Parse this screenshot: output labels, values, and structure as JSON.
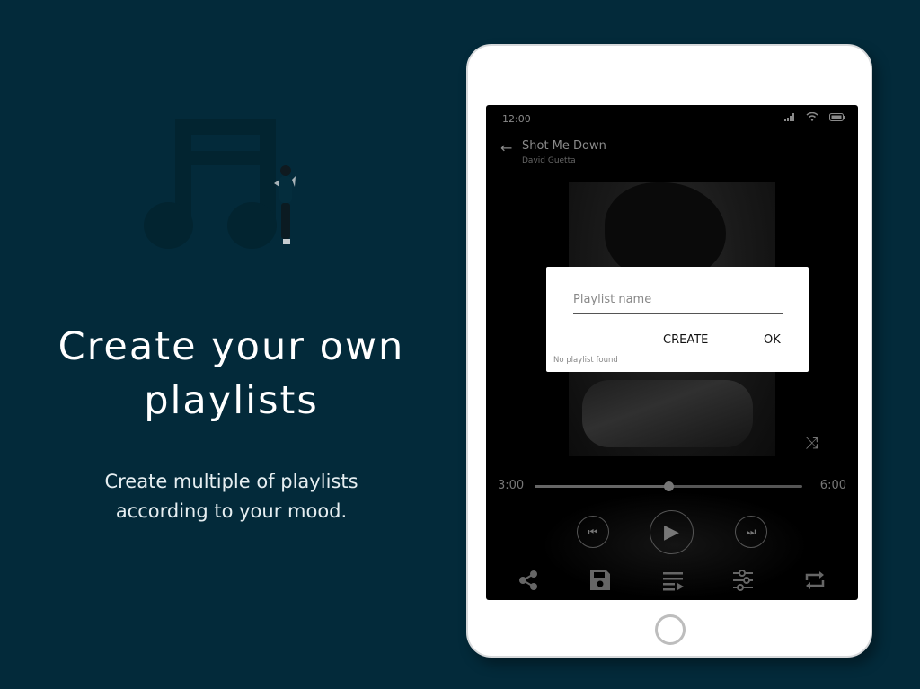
{
  "promo": {
    "headline_line1": "Create your own",
    "headline_line2": "playlists",
    "subtext_line1": "Create multiple of playlists",
    "subtext_line2": "according to your mood."
  },
  "colors": {
    "background": "#032a3a",
    "illustration": "#022430",
    "screen": "#000000",
    "dialog": "#ffffff"
  },
  "status_bar": {
    "time": "12:00",
    "icons": [
      "signal-icon",
      "wifi-icon",
      "battery-icon"
    ]
  },
  "player": {
    "back_icon": "←",
    "song_title": "Shot Me Down",
    "artist": "David Guetta",
    "shuffle_icon": "⤨",
    "elapsed": "3:00",
    "duration": "6:00",
    "progress": 0.5,
    "prev_icon": "⏮",
    "play_icon": "▶",
    "next_icon": "⏭",
    "bottom_icons": [
      {
        "name": "share-icon",
        "glyph": "⋖"
      },
      {
        "name": "save-icon",
        "glyph": "💾"
      },
      {
        "name": "queue-icon",
        "glyph": "≡"
      },
      {
        "name": "equalizer-icon",
        "glyph": "⚙"
      },
      {
        "name": "repeat-icon",
        "glyph": "⇄"
      }
    ]
  },
  "dialog": {
    "input_placeholder": "Playlist name",
    "input_value": "",
    "create_label": "CREATE",
    "ok_label": "OK",
    "empty_message": "No playlist found"
  }
}
